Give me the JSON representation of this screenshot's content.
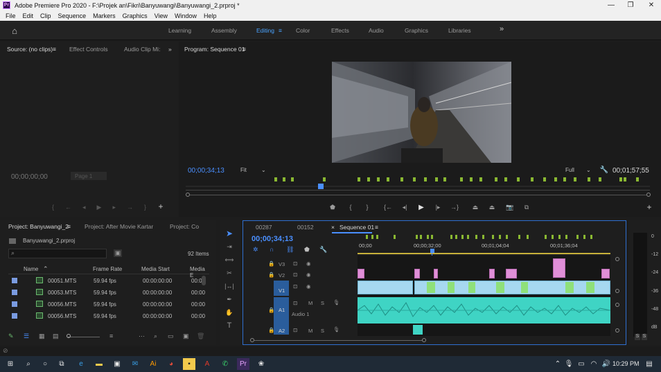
{
  "window": {
    "title": "Adobe Premiere Pro 2020 - F:\\Projek an\\Fikri\\Banyuwangi\\Banyuwangi_2.prproj *",
    "logo": "Pr",
    "controls": [
      "—",
      "❐",
      "✕"
    ]
  },
  "menu": [
    "File",
    "Edit",
    "Clip",
    "Sequence",
    "Markers",
    "Graphics",
    "View",
    "Window",
    "Help"
  ],
  "workspaces": {
    "items": [
      "Learning",
      "Assembly",
      "Editing",
      "Effects",
      "Audio",
      "Graphics",
      "Libraries"
    ],
    "color_tab": "Color",
    "active": "Editing",
    "more": "»"
  },
  "source_panel": {
    "tabs": [
      "Source: (no clips)",
      "Effect Controls",
      "Audio Clip Mi:"
    ],
    "timecode": "00;00;00;00",
    "page": "Page 1"
  },
  "program_panel": {
    "title": "Program: Sequence 01",
    "timecode": "00;00;34;13",
    "fit": "Fit",
    "resolution": "Full",
    "duration": "00;01;57;55"
  },
  "project_panel": {
    "tabs": [
      "Project: Banyuwangi_2",
      "Project: After Movie Kartar",
      "Project: Co"
    ],
    "file": "Banyuwangi_2.prproj",
    "search_placeholder": "",
    "item_count": "92 Items",
    "columns": [
      "Name",
      "Frame Rate",
      "Media Start",
      "Media E"
    ],
    "rows": [
      {
        "name": "00051.MTS",
        "fps": "59.94 fps",
        "start": "00:00:00:00",
        "end": "00:00"
      },
      {
        "name": "00053.MTS",
        "fps": "59.94 fps",
        "start": "00:00:00:00",
        "end": "00:00"
      },
      {
        "name": "00056.MTS",
        "fps": "59.94 fps",
        "start": "00:00:00:00",
        "end": "00:00"
      },
      {
        "name": "00056.MTS",
        "fps": "59.94 fps",
        "start": "00:00:00:00",
        "end": "00:00"
      }
    ]
  },
  "timeline": {
    "tabs": [
      "00287",
      "00152",
      "Sequence 01"
    ],
    "timecode": "00;00;34;13",
    "ruler": [
      "00;00",
      "00;00;32;00",
      "00;01;04;04",
      "00;01;36;04"
    ],
    "tracks": [
      {
        "id": "V3",
        "kind": "video"
      },
      {
        "id": "V2",
        "kind": "video"
      },
      {
        "id": "V1",
        "kind": "video"
      },
      {
        "id": "A1",
        "kind": "audio",
        "name": "Audio 1"
      },
      {
        "id": "A2",
        "kind": "audio"
      }
    ],
    "audio_buttons": [
      "M",
      "S"
    ]
  },
  "meter": {
    "ticks": [
      "0",
      "-12",
      "-24",
      "-36",
      "-48",
      "dB"
    ],
    "solo": [
      "S",
      "S"
    ]
  },
  "taskbar": {
    "time": "10:29 PM"
  },
  "colors": {
    "accent": "#4a8fff",
    "video_clip": "#a6d8f0",
    "audio_clip": "#3fd4c4",
    "marker": "#8ab832",
    "adjustment_clip": "#e08fd8"
  }
}
